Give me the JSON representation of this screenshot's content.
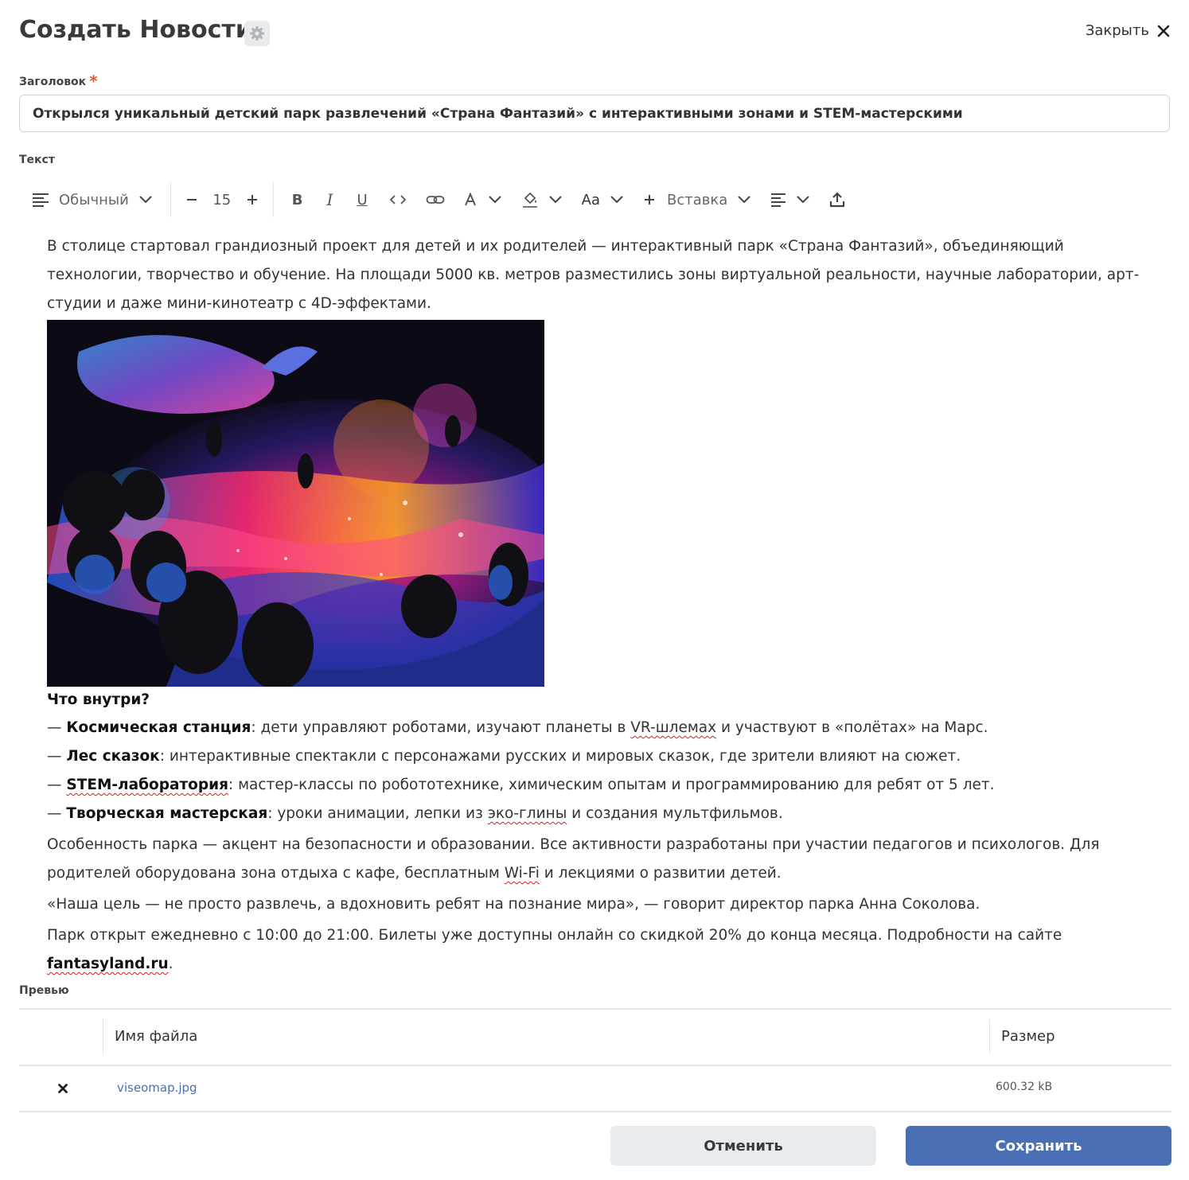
{
  "header": {
    "title": "Создать Новости",
    "close_label": "Закрыть"
  },
  "title_field": {
    "label": "Заголовок",
    "required_mark": "*",
    "value": "Открылся уникальный детский парк развлечений «Страна Фантазий» с интерактивными зонами и STEM-мастерскими"
  },
  "text_field": {
    "label": "Текст"
  },
  "toolbar": {
    "block_type": "Обычный",
    "font_size": "15",
    "case_label": "Aa",
    "insert_label": "Вставка"
  },
  "content": {
    "intro": "В столице стартовал грандиозный проект для детей и их родителей — интерактивный парк «Страна Фантазий», объединяющий технологии, творчество и обучение. На площади 5000 кв. метров разместились зоны виртуальной реальности, научные лаборатории, арт-студии и даже мини-кинотеатр с 4D-эффектами.",
    "inside_heading": "Что внутри?",
    "dash": "— ",
    "item1_title": "Космическая станция",
    "item1_a": ": дети управляют роботами, изучают планеты в ",
    "item1_spell": "VR-шлемах",
    "item1_b": " и участвуют в «полётах» на Марс.",
    "item2_title": "Лес сказок",
    "item2_text": ": интерактивные спектакли с персонажами русских и мировых сказок, где зрители влияют на сюжет.",
    "item3_title": "STEM-лаборатория",
    "item3_text": ": мастер-классы по робототехнике, химическим опытам и программированию для ребят от 5 лет.",
    "item4_title": "Творческая мастерская",
    "item4_a": ": уроки анимации, лепки из ",
    "item4_spell": "эко-глины",
    "item4_b": " и создания мультфильмов.",
    "feature_a": "Особенность парка — акцент на безопасности и образовании. Все активности разработаны при участии педагогов и психологов. Для родителей оборудована зона отдыха с кафе, бесплатным ",
    "feature_spell": "Wi-Fi",
    "feature_b": " и лекциями о развитии детей.",
    "quote": "«Наша цель — не просто развлечь, а вдохновить ребят на познание мира», — говорит директор парка Анна Соколова.",
    "hours": "Парк открыт ежедневно с 10:00 до 21:00. Билеты уже доступны онлайн со скидкой 20% до конца месяца. Подробности на сайте ",
    "site": "fantasyland.ru",
    "hours_end": "."
  },
  "preview": {
    "label": "Превью",
    "col_name": "Имя файла",
    "col_size": "Размер",
    "rows": [
      {
        "filename": "viseomap.jpg",
        "size": "600.32 kB"
      }
    ]
  },
  "actions": {
    "cancel": "Отменить",
    "save": "Сохранить"
  },
  "colors": {
    "accent": "#4a6fb5",
    "required": "#e8572a",
    "cancel_bg": "#e9ecef"
  }
}
